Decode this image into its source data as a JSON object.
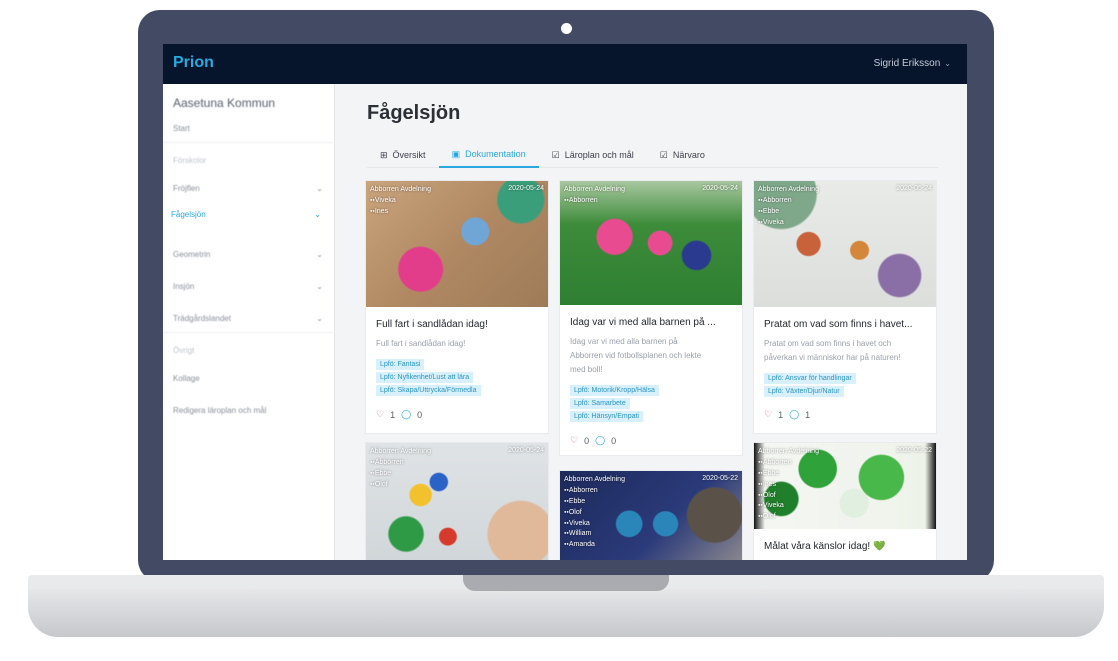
{
  "app": {
    "brand": "Prion",
    "user": "Sigrid Eriksson"
  },
  "sidebar": {
    "org": "Aasetuna Kommun",
    "items": [
      {
        "label": "Start"
      },
      {
        "label": "Förskolor"
      },
      {
        "label": "Fröjflen"
      },
      {
        "label": "Fågelsjön"
      },
      {
        "label": "Geometrin"
      },
      {
        "label": "Insjön"
      },
      {
        "label": "Trädgårdslandet"
      },
      {
        "label": "Övrigt"
      },
      {
        "label": "Kollage"
      },
      {
        "label": "Redigera läroplan och mål"
      }
    ]
  },
  "main": {
    "title": "Fågelsjön",
    "tabs": [
      {
        "label": "Översikt",
        "icon": "grid-icon"
      },
      {
        "label": "Dokumentation",
        "icon": "image-icon"
      },
      {
        "label": "Läroplan och mål",
        "icon": "checkbox-icon"
      },
      {
        "label": "Närvaro",
        "icon": "checkbox-icon"
      }
    ]
  },
  "cards": [
    {
      "group": "Abborren Avdelning",
      "date": "2020-05-24",
      "people": [
        "Viveka",
        "Ines"
      ],
      "title": "Full fart i sandlådan idag!",
      "desc": [
        "Full fart i sandlådan idag!"
      ],
      "tags": [
        "Lpfö: Fantasi",
        "Lpfö: Nyfikenhet/Lust att lära",
        "Lpfö: Skapa/Uttrycka/Förmedla"
      ],
      "likes": "1",
      "comments": "0"
    },
    {
      "group": "Abborren Avdelning",
      "date": "2020-05-24",
      "people": [
        "Abborren"
      ],
      "title": "Idag var vi med alla barnen på ...",
      "desc": [
        "Idag var vi med alla barnen på",
        "Abborren vid fotbollsplanen och lekte",
        "med boll!"
      ],
      "tags": [
        "Lpfö: Motorik/Kropp/Hälsa",
        "Lpfö: Samarbete",
        "Lpfö: Hänsyn/Empati"
      ],
      "likes": "0",
      "comments": "0"
    },
    {
      "group": "Abborren Avdelning",
      "date": "2020-05-24",
      "people": [
        "Abborren",
        "Ebbe",
        "Viveka"
      ],
      "title": "Pratat om vad som finns i havet...",
      "desc": [
        "Pratat om vad som finns i havet och",
        "påverkan vi människor har på naturen!"
      ],
      "tags": [
        "Lpfö: Ansvar för handlingar",
        "Lpfö: Växter/Djur/Natur"
      ],
      "likes": "1",
      "comments": "1"
    },
    {
      "group": "Abborren Avdelning",
      "date": "2020-05-24",
      "people": [
        "Abborren",
        "Ebbe",
        "Olof"
      ]
    },
    {
      "group": "Abborren Avdelning",
      "date": "2020-05-22",
      "people": [
        "Abborren",
        "Ebbe",
        "Olof",
        "Viveka",
        "William",
        "Amanda"
      ]
    },
    {
      "group": "Abborren Avdelning",
      "date": "2020-05-22",
      "people": [
        "Abborren",
        "Ebbe",
        "Ines",
        "Olof",
        "Viveka",
        "Olof"
      ],
      "title": "Målat våra känslor idag! 💚"
    }
  ]
}
